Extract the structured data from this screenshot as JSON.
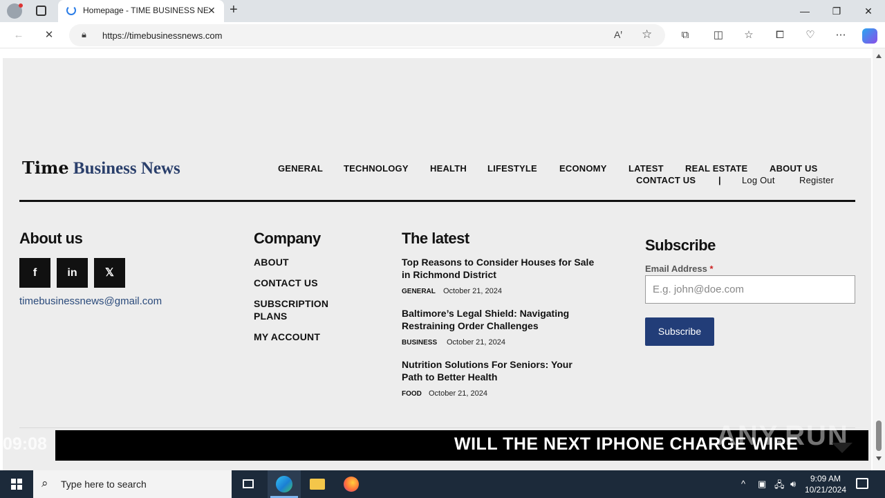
{
  "browser": {
    "tab_title": "Homepage - TIME BUSINESS NEWS",
    "url": "https://timebusinessnews.com"
  },
  "site": {
    "logo_part1": "Time",
    "logo_part2": "Business News",
    "nav": [
      "GENERAL",
      "TECHNOLOGY",
      "HEALTH",
      "LIFESTYLE",
      "ECONOMY",
      "LATEST",
      "REAL ESTATE",
      "ABOUT US"
    ],
    "nav2": [
      "CONTACT US",
      "|",
      "Log Out",
      "Register"
    ]
  },
  "footer": {
    "about_heading": "About us",
    "social": [
      "f",
      "in",
      "𝕏"
    ],
    "email": "timebusinessnews@gmail.com",
    "company_heading": "Company",
    "company_links": [
      "ABOUT",
      "CONTACT US",
      "SUBSCRIPTION",
      "PLANS",
      "MY ACCOUNT"
    ],
    "latest_heading": "The latest",
    "articles": [
      {
        "title": "Top Reasons to Consider Houses for Sale in Richmond District",
        "category": "GENERAL",
        "date": "October 21, 2024"
      },
      {
        "title": "Baltimore’s Legal Shield: Navigating Restraining Order Challenges",
        "category": "BUSINESS",
        "date": "October 21, 2024"
      },
      {
        "title": "Nutrition Solutions For Seniors: Your Path to Better Health",
        "category": "FOOD",
        "date": "October 21, 2024"
      }
    ],
    "subscribe_heading": "Subscribe",
    "email_label": "Email Address",
    "required_mark": "*",
    "email_placeholder": "E.g. john@doe.com",
    "subscribe_button": "Subscribe"
  },
  "ticker": {
    "time": "09:08",
    "text": "WILL THE NEXT IPHONE CHARGE WIRE"
  },
  "watermark": "ANY.RUN",
  "taskbar": {
    "search_placeholder": "Type here to search",
    "time": "9:09 AM",
    "date": "10/21/2024"
  },
  "colors": {
    "brand_blue": "#2a3f6b",
    "button_blue": "#223d78"
  }
}
